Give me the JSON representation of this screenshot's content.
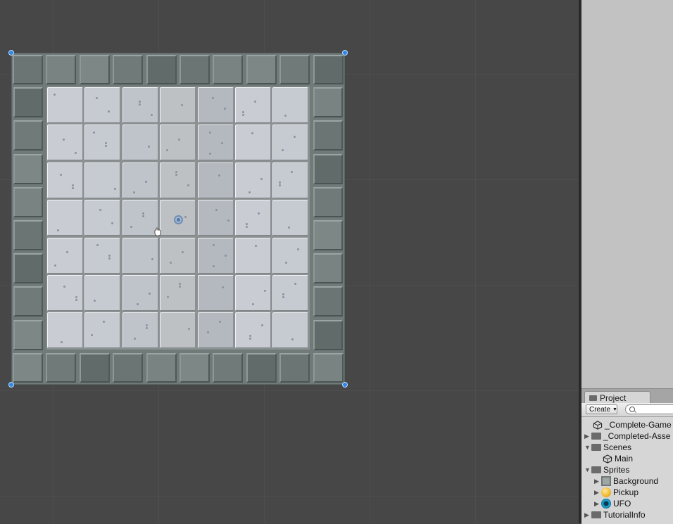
{
  "project_panel": {
    "tab_label": "Project",
    "create_label": "Create",
    "search_placeholder": ""
  },
  "project_tree": [
    {
      "label": "_Complete-Game",
      "type": "scene"
    },
    {
      "label": "_Completed-Asse",
      "type": "folder",
      "state": "collapsed"
    },
    {
      "label": "Scenes",
      "type": "folder",
      "state": "expanded"
    },
    {
      "label": "Main",
      "type": "scene"
    },
    {
      "label": "Sprites",
      "type": "folder",
      "state": "expanded"
    },
    {
      "label": "Background",
      "type": "sprite",
      "state": "collapsed"
    },
    {
      "label": "Pickup",
      "type": "sprite",
      "state": "collapsed"
    },
    {
      "label": "UFO",
      "type": "sprite",
      "state": "collapsed"
    },
    {
      "label": "TutorialInfo",
      "type": "folder",
      "state": "collapsed"
    }
  ],
  "colors": {
    "editor_background": "#474747",
    "handle_blue": "#2f86e6",
    "border_tile": "#6f7a79",
    "floor_tile": "#c4c8cf",
    "pickup_icon": "#f0b82a",
    "ufo_icon": "#22b5e0"
  }
}
